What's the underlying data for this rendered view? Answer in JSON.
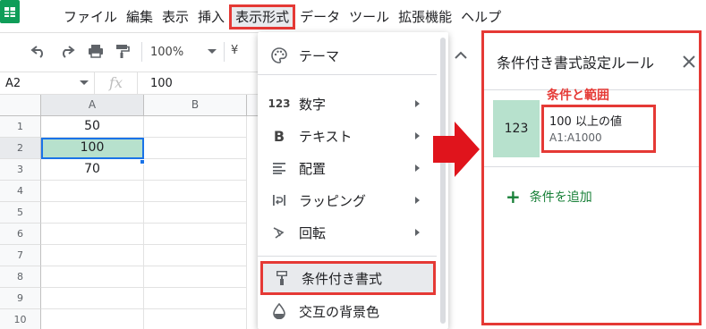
{
  "menu": {
    "items": [
      "ファイル",
      "編集",
      "表示",
      "挿入",
      "表示形式",
      "データ",
      "ツール",
      "拡張機能",
      "ヘルプ"
    ],
    "active_index": 4
  },
  "toolbar": {
    "zoom": "100%",
    "currency_symbol": "¥"
  },
  "formula_bar": {
    "cell_ref": "A2",
    "fx": "fx",
    "value": "100"
  },
  "sheet": {
    "columns": [
      "A",
      "B"
    ],
    "rows": [
      "1",
      "2",
      "3",
      "4",
      "5",
      "6",
      "7",
      "8",
      "9",
      "10"
    ],
    "cells": [
      "50",
      "100",
      "70"
    ],
    "highlight_color": "#b7e1cd",
    "selection_color": "#1a73e8"
  },
  "format_menu": {
    "items": [
      {
        "label": "テーマ",
        "icon": "palette-icon",
        "icon_text": ""
      },
      {
        "label": "数字",
        "icon": "number-icon",
        "icon_text": "123",
        "submenu": true
      },
      {
        "label": "テキスト",
        "icon": "bold-icon",
        "icon_text": "B",
        "submenu": true
      },
      {
        "label": "配置",
        "icon": "align-icon",
        "icon_text": "",
        "submenu": true
      },
      {
        "label": "ラッピング",
        "icon": "wrap-icon",
        "icon_text": "",
        "submenu": true
      },
      {
        "label": "回転",
        "icon": "rotate-icon",
        "icon_text": "",
        "submenu": true
      },
      {
        "label": "条件付き書式",
        "icon": "paint-roller-icon",
        "icon_text": ""
      },
      {
        "label": "交互の背景色",
        "icon": "fill-drop-icon",
        "icon_text": ""
      }
    ]
  },
  "side_panel": {
    "title": "条件付き書式設定ルール",
    "annotation": "条件と範囲",
    "rule": {
      "preview": "123",
      "condition_value": "100",
      "condition_text": "以上の値",
      "range": "A1:A1000"
    },
    "add_label": "条件を追加",
    "add_color": "#188038"
  },
  "annotation_color": "#e53935"
}
